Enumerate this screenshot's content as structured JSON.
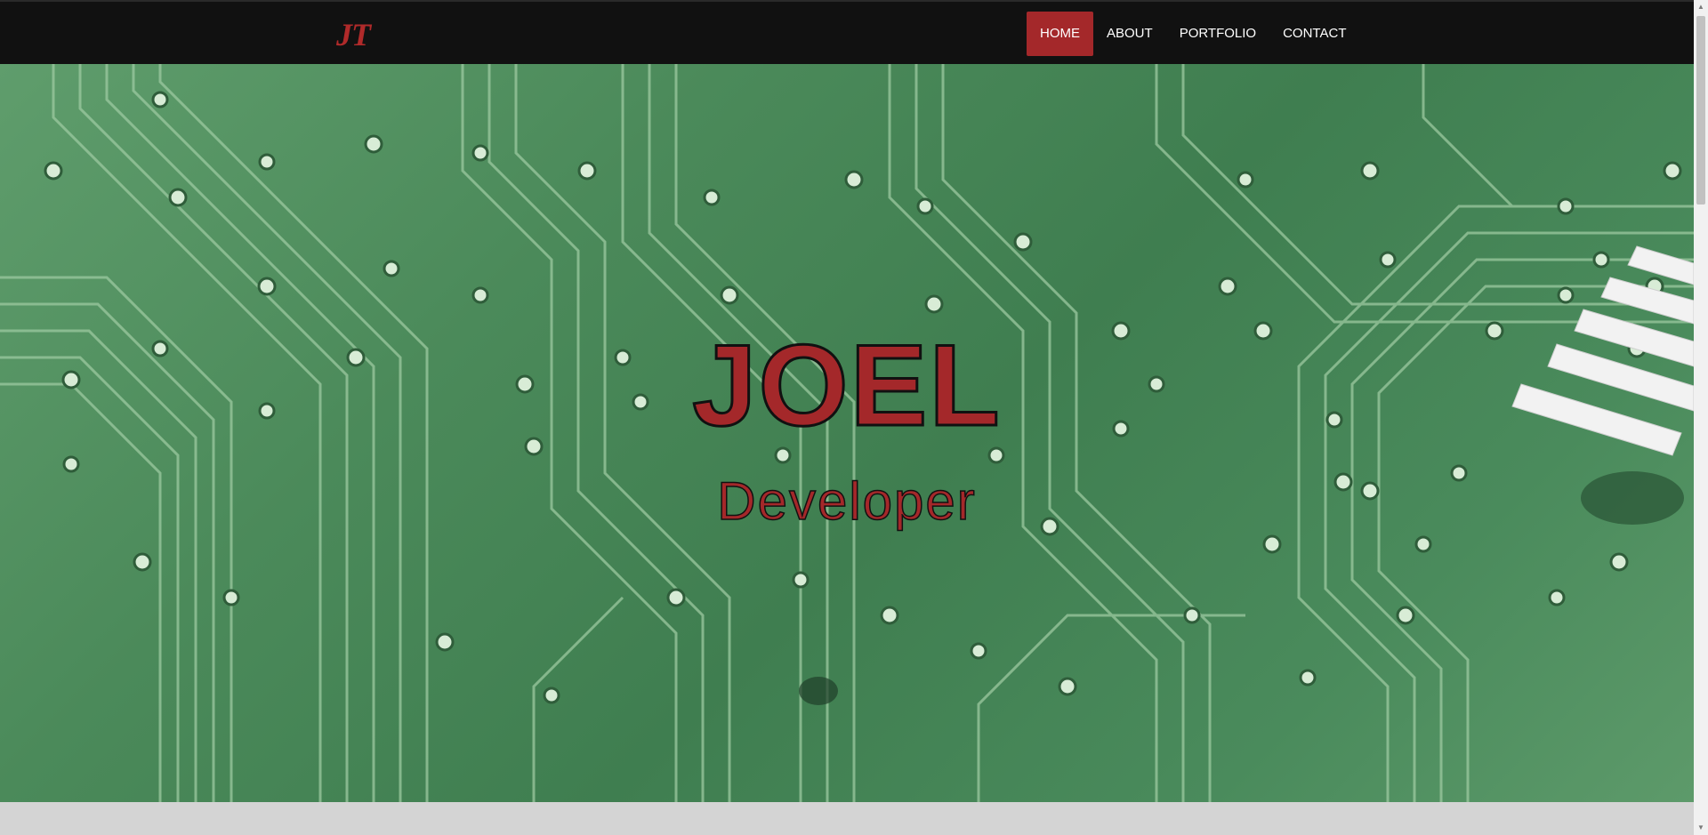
{
  "brand": {
    "logo_text": "JT"
  },
  "nav": {
    "items": [
      {
        "label": "HOME",
        "active": true
      },
      {
        "label": "ABOUT",
        "active": false
      },
      {
        "label": "PORTFOLIO",
        "active": false
      },
      {
        "label": "CONTACT",
        "active": false
      }
    ]
  },
  "hero": {
    "title": "JOEL",
    "subtitle": "Developer",
    "background_icon": "circuit-board-image"
  },
  "colors": {
    "accent": "#a4282a",
    "navbar": "#111111",
    "page_background": "#d4d4d4",
    "board_green": "#4b8a5a"
  }
}
